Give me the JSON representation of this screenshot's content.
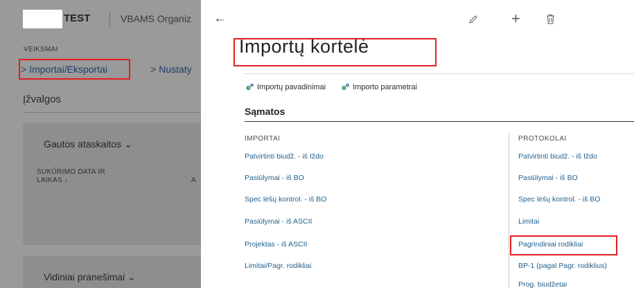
{
  "background": {
    "app_name": "TEST",
    "org_name": "VBAMS Organiz",
    "actions_heading": "VEIKSMAI",
    "nav": [
      {
        "label": "Importai/Eksportai"
      },
      {
        "label": "Nustaty"
      }
    ],
    "insights_heading": "Įžvalgos",
    "cards": [
      {
        "title": "Gautos ataskaitos",
        "col1_line1": "SUKŪRIMO DATA IR",
        "col1_line2": "LAIKAS ↓",
        "col2": "A"
      },
      {
        "title": "Vidiniai pranešimai"
      }
    ]
  },
  "page": {
    "title": "Importų kortelė",
    "actions": [
      {
        "label": "Importų pavadinimai"
      },
      {
        "label": "Importo parametrai"
      }
    ],
    "section_title": "Sąmatos",
    "left_column": {
      "heading": "IMPORTAI",
      "links": [
        "Patvirtinti biudž. - iš Iždo",
        "Pasiūlymai - iš BO",
        "Spec lėšų kontrol. - iš BO",
        "Pasiūlymai - iš ASCII",
        "Projektas - iš ASCII",
        "Limitai/Pagr. rodikliai"
      ]
    },
    "right_column": {
      "heading": "PROTOKOLAI",
      "links": [
        "Patvirtinti biudž. - iš Iždo",
        "Pasiūlymai - iš BO",
        "Spec lėšų kontrol. - iš BO",
        "Limitai",
        "Pagrindiniai rodikliai",
        "BP-1 (pagal Pagr. rodiklius)",
        "Prog. biudžetai"
      ]
    }
  },
  "colors": {
    "highlight": "#e41e1e",
    "link": "#1f5f8b",
    "dimmed_pane": "#9a9a9a"
  },
  "icons": [
    "back-arrow-icon",
    "edit-icon",
    "add-icon",
    "delete-icon",
    "gear-icon",
    "chevron-right-icon",
    "chevron-down-icon"
  ]
}
